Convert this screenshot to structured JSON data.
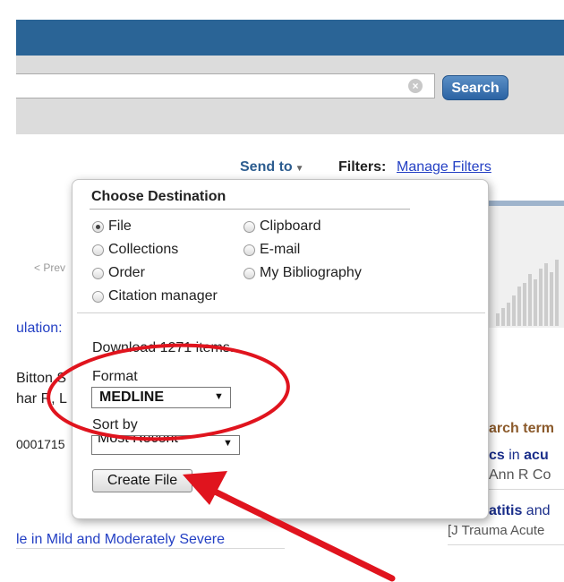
{
  "search": {
    "button_label": "Search",
    "value": ""
  },
  "toolbar": {
    "send_to": "Send to",
    "filters_label": "Filters:",
    "filters_link": "Manage Filters"
  },
  "background": {
    "prev": "< Prev",
    "title_fragment": "ulation:",
    "authors_line1": "Bitton S",
    "authors_line2": "har R, L",
    "id_fragment": "0001715",
    "bottom_title": "le in Mild and Moderately Severe",
    "search_terms_heading": "arch term",
    "result1_a": "cs",
    "result1_b": " in ",
    "result1_c": "acu",
    "result1_source": "Ann R Co",
    "result2_a": "atitis",
    "result2_b": " and",
    "result2_source": "[J Trauma Acute"
  },
  "popup": {
    "title": "Choose Destination",
    "options": [
      {
        "label": "File",
        "checked": true
      },
      {
        "label": "Clipboard",
        "checked": false
      },
      {
        "label": "Collections",
        "checked": false
      },
      {
        "label": "E-mail",
        "checked": false
      },
      {
        "label": "Order",
        "checked": false
      },
      {
        "label": "My Bibliography",
        "checked": false
      },
      {
        "label": "Citation manager",
        "checked": false
      }
    ],
    "download_text": "Download 1271 items.",
    "format_label": "Format",
    "format_value": "MEDLINE",
    "sort_label": "Sort by",
    "sort_value": "Most Recent",
    "create_button": "Create File"
  },
  "colors": {
    "header_blue": "#2a6496",
    "link_blue": "#2440c4",
    "annotation_red": "#e0141e",
    "search_terms_brown": "#8b5a2b"
  }
}
